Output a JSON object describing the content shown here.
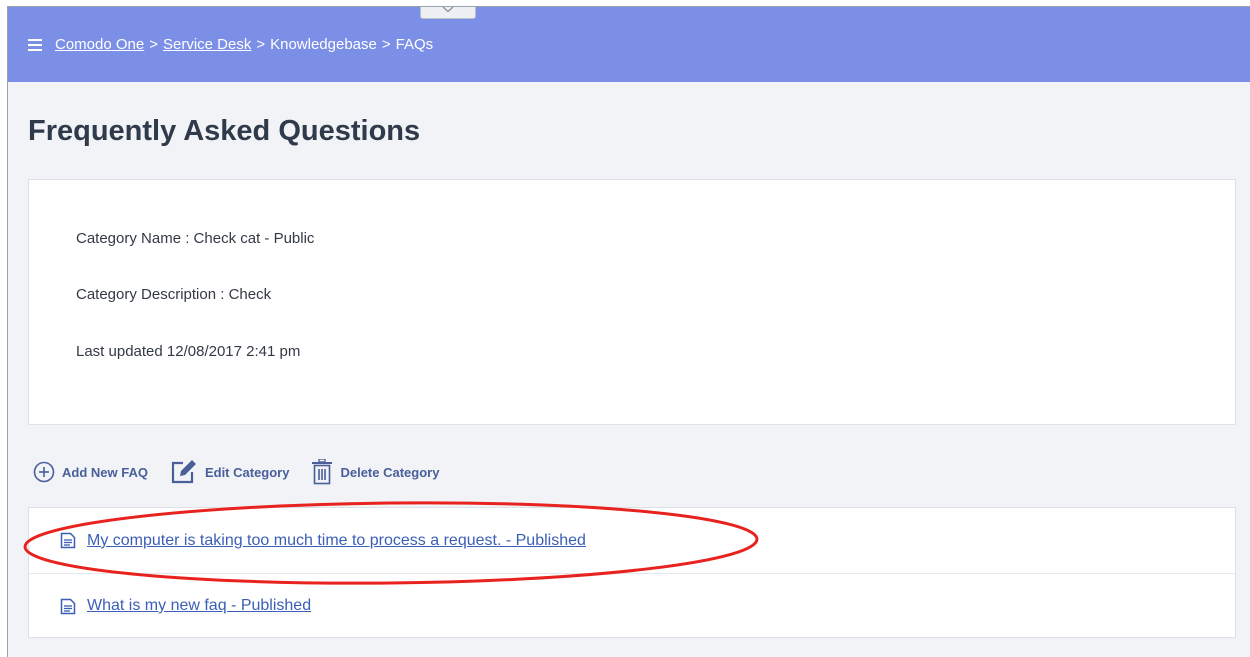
{
  "breadcrumb": {
    "items": [
      {
        "label": "Comodo One",
        "link": true
      },
      {
        "label": "Service Desk",
        "link": true
      },
      {
        "label": "Knowledgebase",
        "link": false
      },
      {
        "label": "FAQs",
        "link": false
      }
    ],
    "separator": ">"
  },
  "page": {
    "title": "Frequently Asked Questions"
  },
  "category": {
    "name_line": "Category Name : Check cat - Public",
    "description_line": "Category Description : Check",
    "updated_line": "Last updated 12/08/2017 2:41 pm"
  },
  "actions": {
    "add_label": "Add New FAQ",
    "edit_label": "Edit Category",
    "delete_label": "Delete Category"
  },
  "faqs": [
    {
      "title": "My computer is taking too much time to process a request. - Published",
      "icon": "document-icon"
    },
    {
      "title": "What is my new faq - Published",
      "icon": "document-icon"
    }
  ],
  "colors": {
    "header": "#7b8fe6",
    "link": "#3b5eb6",
    "annotation": "#e8231f"
  }
}
